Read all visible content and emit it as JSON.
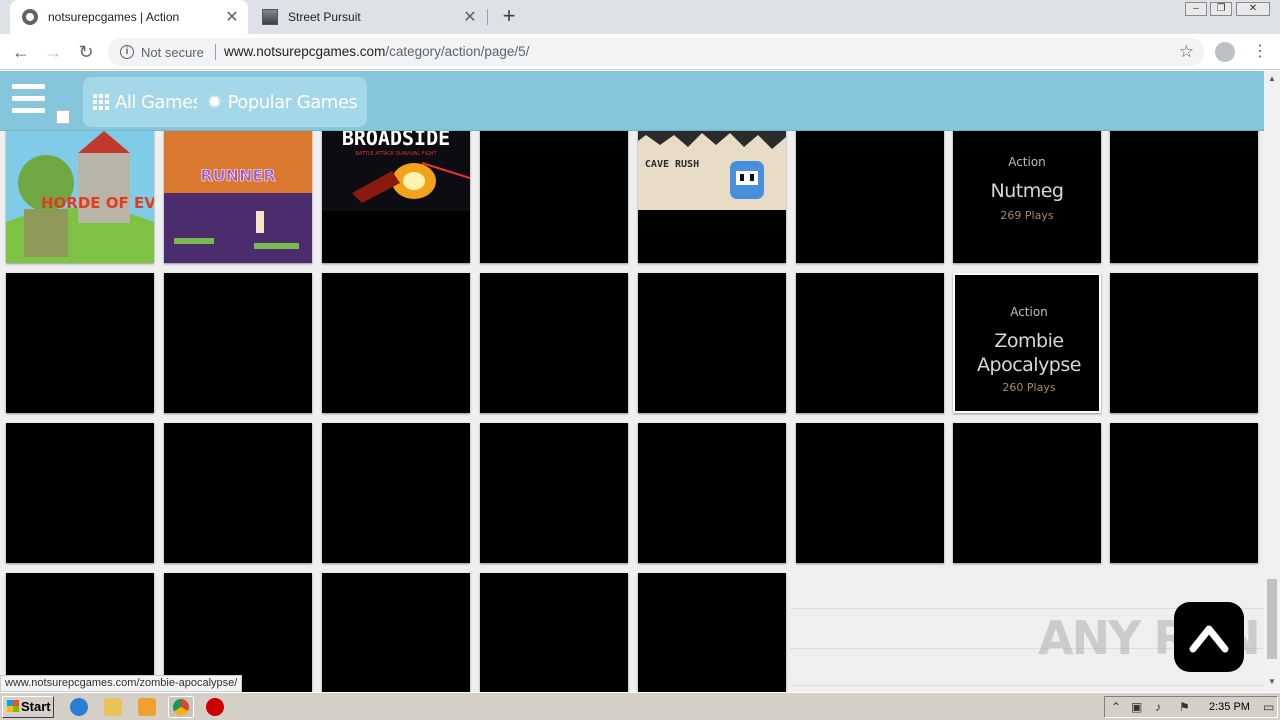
{
  "browser": {
    "tabs": [
      {
        "title": "notsurepcgames | Action",
        "active": true
      },
      {
        "title": "Street Pursuit",
        "active": false
      }
    ],
    "newtab_symbol": "+",
    "close_symbol": "✕",
    "security_label": "Not secure",
    "url_host": "www.notsurepcgames.com",
    "url_path": "/category/action/page/5/",
    "status_url": "www.notsurepcgames.com/zombie-apocalypse/"
  },
  "header": {
    "all_games": "All Games",
    "popular_games": "Popular Games"
  },
  "cards_with_meta": [
    {
      "category": "Action",
      "name": "Nutmeg",
      "plays": "269 Plays"
    },
    {
      "category": "Action",
      "name": "Zombie Apocalypse",
      "plays": "260 Plays"
    }
  ],
  "thumb_texts": {
    "horde": "HORDE OF EVIL",
    "runner": "RUNNER",
    "broadside": "BROADSIDE",
    "broadside_sub": "BATTLE ATTACK SURVIVAL FIGHT",
    "cave": "CAVE RUSH"
  },
  "watermark": "ANY RUN",
  "taskbar": {
    "start": "Start",
    "clock": "2:35 PM"
  },
  "colors": {
    "header_bg": "#86c6dc",
    "header_button_bg": "#a4d7e8",
    "card_bg": "#000000",
    "page_bg": "#efefef"
  }
}
